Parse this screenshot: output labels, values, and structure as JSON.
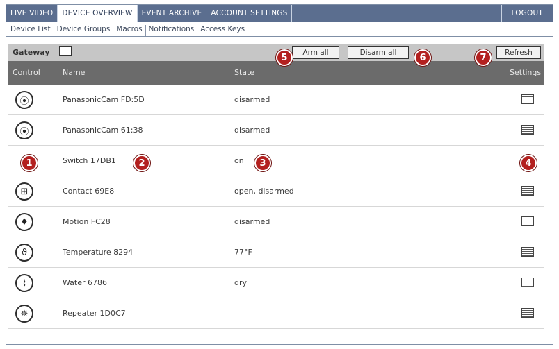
{
  "top_tabs": [
    {
      "label": "LIVE VIDEO"
    },
    {
      "label": "DEVICE OVERVIEW"
    },
    {
      "label": "EVENT ARCHIVE"
    },
    {
      "label": "ACCOUNT SETTINGS"
    }
  ],
  "logout_label": "LOGOUT",
  "sub_tabs": [
    {
      "label": "Device List"
    },
    {
      "label": "Device Groups"
    },
    {
      "label": "Macros"
    },
    {
      "label": "Notifications"
    },
    {
      "label": "Access Keys"
    }
  ],
  "toolbar": {
    "gateway_label": "Gateway",
    "arm_all_label": "Arm all",
    "disarm_all_label": "Disarm all",
    "refresh_label": "Refresh"
  },
  "table_headers": {
    "control": "Control",
    "name": "Name",
    "state": "State",
    "settings": "Settings"
  },
  "devices": [
    {
      "icon": "camera-icon",
      "glyph": "⦿",
      "name": "PanasonicCam FD:5D",
      "state": "disarmed"
    },
    {
      "icon": "camera-icon",
      "glyph": "⦿",
      "name": "PanasonicCam 61:38",
      "state": "disarmed"
    },
    {
      "icon": "switch-icon",
      "glyph": "",
      "name": "Switch 17DB1",
      "state": "on"
    },
    {
      "icon": "contact-sensor-icon",
      "glyph": "⊞",
      "name": "Contact 69E8",
      "state": "open, disarmed"
    },
    {
      "icon": "motion-sensor-icon",
      "glyph": "♦",
      "name": "Motion FC28",
      "state": "disarmed"
    },
    {
      "icon": "temperature-sensor-icon",
      "glyph": "ϑ",
      "name": "Temperature 8294",
      "state": "77°F"
    },
    {
      "icon": "water-sensor-icon",
      "glyph": "⌇",
      "name": "Water 6786",
      "state": "dry"
    },
    {
      "icon": "repeater-icon",
      "glyph": "✵",
      "name": "Repeater 1D0C7",
      "state": ""
    }
  ],
  "callouts": {
    "c1": "1",
    "c2": "2",
    "c3": "3",
    "c4": "4",
    "c5": "5",
    "c6": "6",
    "c7": "7"
  },
  "colors": {
    "topbar": "#5b6e8f",
    "header_row": "#6b6b6b",
    "callout": "#b3201f"
  }
}
